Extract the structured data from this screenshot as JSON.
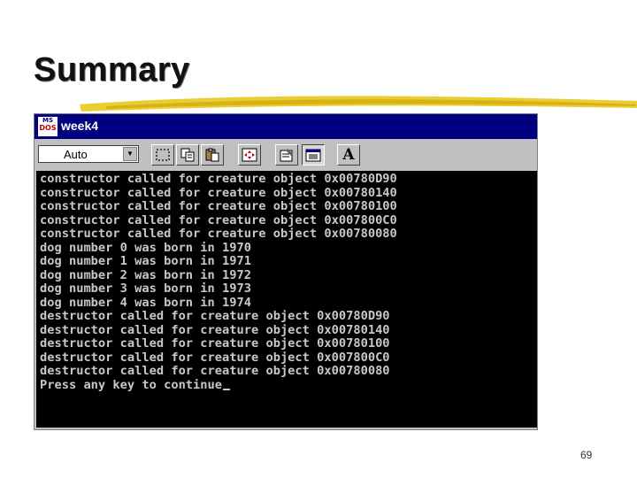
{
  "slide": {
    "title": "Summary",
    "page_number": "69",
    "underline_color": "#e8c81c"
  },
  "window": {
    "title": "week4",
    "logo_top": "MS",
    "logo_bottom": "DOS",
    "titlebar_color": "#000080"
  },
  "toolbar": {
    "font_size_value": "Auto",
    "dropdown_icon": "chevron-down-icon",
    "buttons": [
      {
        "name": "mark-button",
        "icon": "dotted-rect-icon"
      },
      {
        "name": "copy-button",
        "icon": "copy-icon"
      },
      {
        "name": "paste-button",
        "icon": "paste-icon"
      },
      {
        "name": "fullscreen-button",
        "icon": "fullscreen-icon"
      },
      {
        "name": "properties-button",
        "icon": "properties-icon"
      },
      {
        "name": "background-button",
        "icon": "background-icon"
      },
      {
        "name": "font-button",
        "icon": "font-icon",
        "label": "A"
      }
    ]
  },
  "console": {
    "text_color": "#c8c8c8",
    "lines": [
      "constructor called for creature object 0x00780D90",
      "constructor called for creature object 0x00780140",
      "constructor called for creature object 0x00780100",
      "constructor called for creature object 0x007800C0",
      "constructor called for creature object 0x00780080",
      "dog number 0 was born in 1970",
      "dog number 1 was born in 1971",
      "dog number 2 was born in 1972",
      "dog number 3 was born in 1973",
      "dog number 4 was born in 1974",
      "destructor called for creature object 0x00780D90",
      "destructor called for creature object 0x00780140",
      "destructor called for creature object 0x00780100",
      "destructor called for creature object 0x007800C0",
      "destructor called for creature object 0x00780080",
      "Press any key to continue"
    ]
  }
}
